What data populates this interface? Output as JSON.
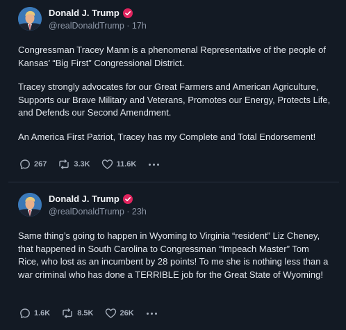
{
  "posts": [
    {
      "display_name": "Donald J. Trump",
      "handle": "@realDonaldTrump",
      "separator": "·",
      "time": "17h",
      "paragraphs": [
        "Congressman Tracey Mann is a phenomenal Representative of the people of Kansas’ “Big First” Congressional District.",
        "Tracey strongly advocates for our Great Farmers and American Agriculture, Supports our Brave Military and Veterans, Promotes our Energy, Protects Life, and Defends our Second Amendment.",
        "An America First Patriot, Tracey has my Complete and Total Endorsement!"
      ],
      "replies": "267",
      "reposts": "3.3K",
      "likes": "11.6K"
    },
    {
      "display_name": "Donald J. Trump",
      "handle": "@realDonaldTrump",
      "separator": "·",
      "time": "23h",
      "paragraphs": [
        "Same thing’s going to happen in Wyoming to Virginia “resident” Liz Cheney, that happened in South Carolina to Congressman “Impeach Master” Tom Rice, who lost as an incumbent by 28 points! To me she is nothing less than a war criminal who has done a TERRIBLE job for the Great State of Wyoming!"
      ],
      "replies": "1.6K",
      "reposts": "8.5K",
      "likes": "26K"
    }
  ],
  "icons": {
    "verified": "verified-badge-icon",
    "reply": "comment-bubble-icon",
    "repost": "repost-arrows-icon",
    "like": "heart-icon",
    "more": "more-dots-icon"
  },
  "colors": {
    "background": "#131a24",
    "verified": "#e0245e",
    "muted": "#8b95a5"
  }
}
